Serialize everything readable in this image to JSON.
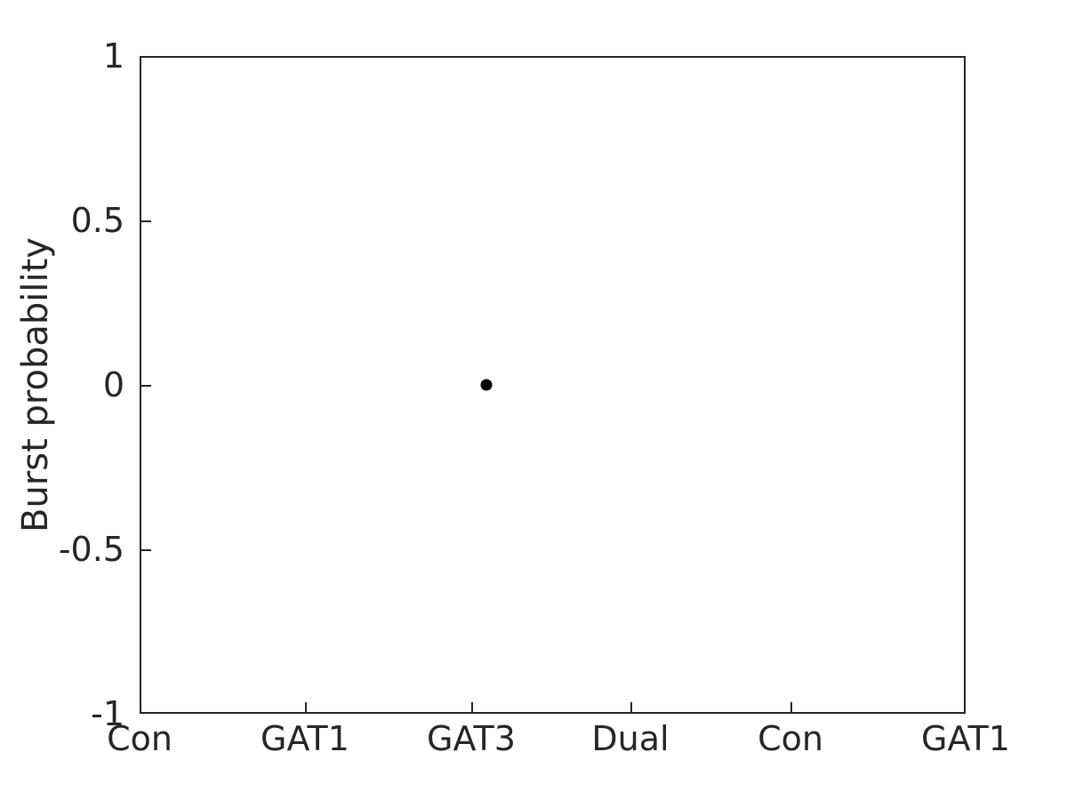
{
  "chart_data": {
    "type": "scatter",
    "title": "",
    "xlabel": "",
    "ylabel": "Burst probability",
    "ylim": [
      -1,
      1
    ],
    "yticks": [
      -1,
      -0.5,
      0,
      0.5,
      1
    ],
    "ytick_labels": [
      "-1",
      "-0.5",
      "0",
      "0.5",
      "1"
    ],
    "xlim": [
      0,
      6
    ],
    "xticks": [
      0,
      1,
      2,
      3,
      4,
      5
    ],
    "categories": [
      "Con",
      "GAT1",
      "GAT3",
      "Dual",
      "Con",
      "GAT1"
    ],
    "grid": false,
    "legend": "none",
    "marker_color": "#000000",
    "marker_shape": "circle",
    "points": [
      {
        "category": "GAT3",
        "x": 2.08,
        "y": 0
      }
    ],
    "series": [
      {
        "name": "Burst probability",
        "categories": [
          "Con",
          "GAT1",
          "GAT3",
          "Dual",
          "Con",
          "GAT1"
        ],
        "values": [
          null,
          null,
          0,
          null,
          null,
          null
        ]
      }
    ]
  },
  "axis": {
    "ytick_labels": [
      "1",
      "0.5",
      "0",
      "-0.5",
      "-1"
    ],
    "xtick_labels": [
      "Con",
      "GAT1",
      "GAT3",
      "Dual",
      "Con",
      "GAT1"
    ],
    "ylabel": "Burst probability"
  },
  "colors": {
    "axis": "#262626",
    "marker": "#000000",
    "background": "#ffffff"
  }
}
